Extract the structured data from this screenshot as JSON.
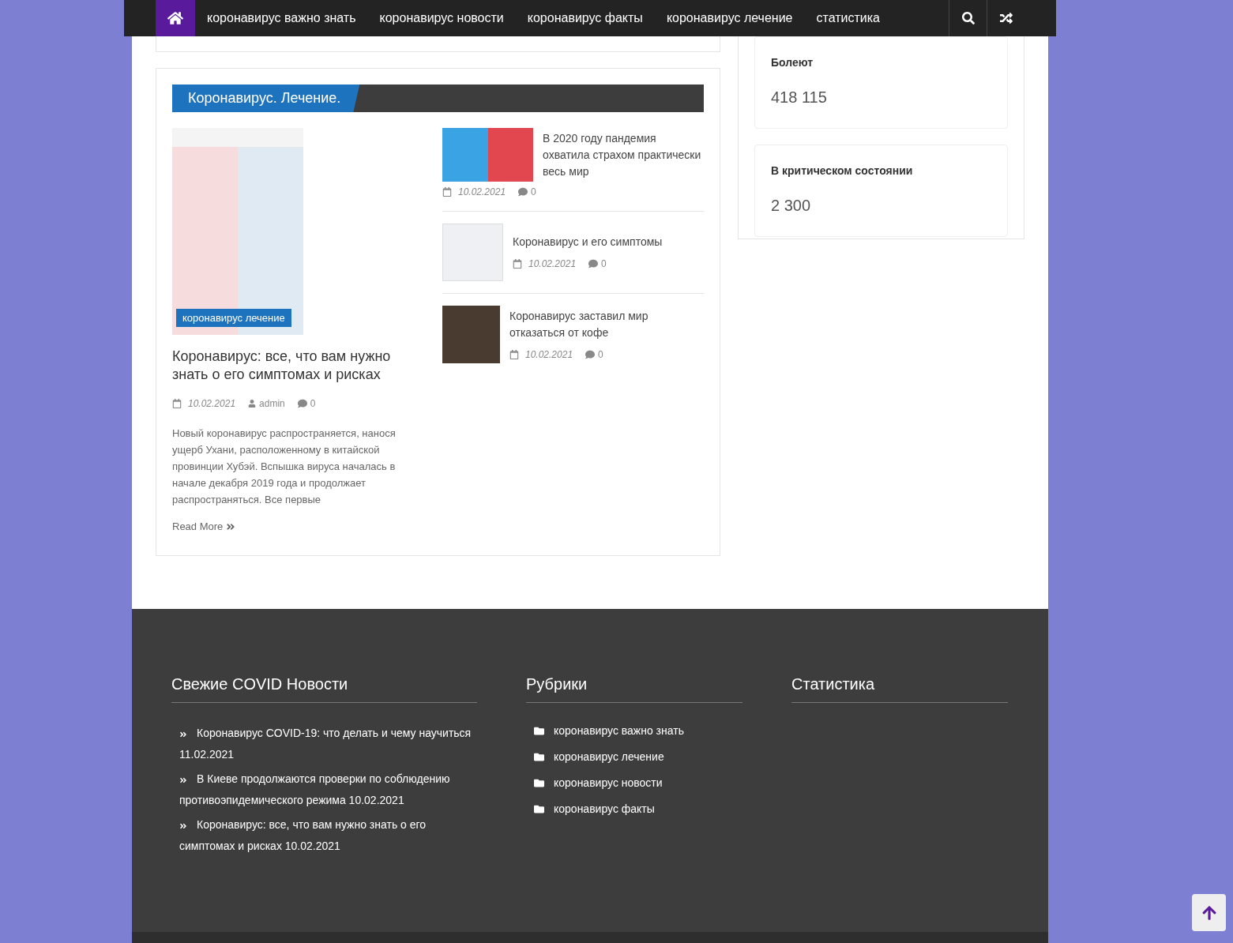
{
  "nav": {
    "items": [
      {
        "label": "коронавирус важно знать",
        "selected": false
      },
      {
        "label": "коронавирус новости",
        "selected": false
      },
      {
        "label": "коронавирус факты",
        "selected": false
      },
      {
        "label": "коронавирус лечение",
        "selected": false
      },
      {
        "label": "статистика",
        "selected": false
      }
    ],
    "home_selected": true
  },
  "section": {
    "title": "Коронавирус. Лечение.",
    "featured": {
      "category": "коронавирус лечение",
      "title": "Коронавирус: все, что вам нужно знать о его симптомах и рисках",
      "date": "10.02.2021",
      "author": "admin",
      "comments": "0",
      "excerpt": "Новый коронавирус распространяется, нанося ущерб Ухани, расположенному в китайской провинции Хубэй. Вспышка вируса началась в начале декабря 2019 года и продолжает распространяться. Все первые",
      "read_more": "Read More"
    },
    "posts": [
      {
        "title": "В 2020 году пандемия охватила страхом практически весь мир",
        "date": "10.02.2021",
        "comments": "0",
        "kind": "split"
      },
      {
        "title": "Коронавирус и его симптомы",
        "date": "10.02.2021",
        "comments": "0",
        "kind": "table"
      },
      {
        "title": "Коронавирус заставил мир отказаться от кофе",
        "date": "10.02.2021",
        "comments": "0",
        "kind": "photo"
      }
    ]
  },
  "stats": [
    {
      "label": "Болеют",
      "value": "418 115"
    },
    {
      "label": "В критическом состоянии",
      "value": "2 300"
    }
  ],
  "footer": {
    "news": {
      "title": "Свежие COVID Новости",
      "items": [
        {
          "title": "Коронавирус COVID-19: что делать и чему научиться",
          "date": "11.02.2021"
        },
        {
          "title": "В Киеве продолжаются проверки по соблюдению противоэпидемического режима",
          "date": "10.02.2021"
        },
        {
          "title": "Коронавирус: все, что вам нужно знать о его симптомах и рисках",
          "date": "10.02.2021"
        }
      ]
    },
    "categories": {
      "title": "Рубрики",
      "items": [
        "коронавирус важно знать",
        "коронавирус лечение",
        "коронавирус новости",
        "коронавирус факты"
      ]
    },
    "stats": {
      "title": "Статистика"
    }
  }
}
